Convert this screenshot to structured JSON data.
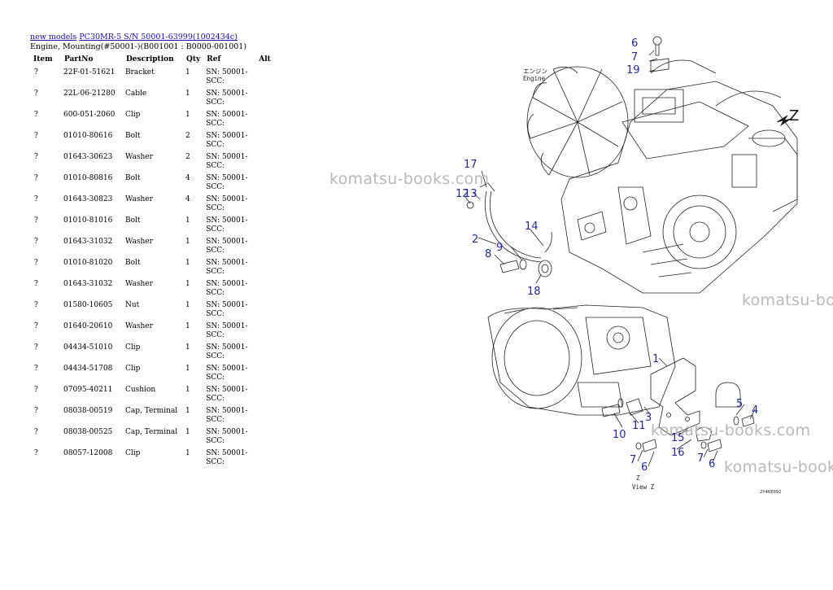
{
  "breadcrumb": {
    "link1": "new models",
    "link2": "PC30MR-5 S/N 50001-63999(1002434c)"
  },
  "subtitle": "Engine, Mounting(#50001-)(B001001 : B0000-001001)",
  "table": {
    "headers": [
      "Item",
      "PartNo",
      "Description",
      "Qty",
      "Ref",
      "Alt"
    ],
    "rows": [
      {
        "item": "?",
        "part": "22F-01-51621",
        "desc": "Bracket",
        "qty": "1",
        "ref": "SN: 50001-SCC:"
      },
      {
        "item": "?",
        "part": "22L-06-21280",
        "desc": "Cable",
        "qty": "1",
        "ref": "SN: 50001-SCC:"
      },
      {
        "item": "?",
        "part": "600-051-2060",
        "desc": "Clip",
        "qty": "1",
        "ref": "SN: 50001-SCC:"
      },
      {
        "item": "?",
        "part": "01010-80616",
        "desc": "Bolt",
        "qty": "2",
        "ref": "SN: 50001-SCC:"
      },
      {
        "item": "?",
        "part": "01643-30623",
        "desc": "Washer",
        "qty": "2",
        "ref": "SN: 50001-SCC:"
      },
      {
        "item": "?",
        "part": "01010-80816",
        "desc": "Bolt",
        "qty": "4",
        "ref": "SN: 50001-SCC:"
      },
      {
        "item": "?",
        "part": "01643-30823",
        "desc": "Washer",
        "qty": "4",
        "ref": "SN: 50001-SCC:"
      },
      {
        "item": "?",
        "part": "01010-81016",
        "desc": "Bolt",
        "qty": "1",
        "ref": "SN: 50001-SCC:"
      },
      {
        "item": "?",
        "part": "01643-31032",
        "desc": "Washer",
        "qty": "1",
        "ref": "SN: 50001-SCC:"
      },
      {
        "item": "?",
        "part": "01010-81020",
        "desc": "Bolt",
        "qty": "1",
        "ref": "SN: 50001-SCC:"
      },
      {
        "item": "?",
        "part": "01643-31032",
        "desc": "Washer",
        "qty": "1",
        "ref": "SN: 50001-SCC:"
      },
      {
        "item": "?",
        "part": "01580-10605",
        "desc": "Nut",
        "qty": "1",
        "ref": "SN: 50001-SCC:"
      },
      {
        "item": "?",
        "part": "01640-20610",
        "desc": "Washer",
        "qty": "1",
        "ref": "SN: 50001-SCC:"
      },
      {
        "item": "?",
        "part": "04434-51010",
        "desc": "Clip",
        "qty": "1",
        "ref": "SN: 50001-SCC:"
      },
      {
        "item": "?",
        "part": "04434-51708",
        "desc": "Clip",
        "qty": "1",
        "ref": "SN: 50001-SCC:"
      },
      {
        "item": "?",
        "part": "07095-40211",
        "desc": "Cushion",
        "qty": "1",
        "ref": "SN: 50001-SCC:"
      },
      {
        "item": "?",
        "part": "08038-00519",
        "desc": "Cap, Terminal",
        "qty": "1",
        "ref": "SN: 50001-SCC:"
      },
      {
        "item": "?",
        "part": "08038-00525",
        "desc": "Cap, Terminal",
        "qty": "1",
        "ref": "SN: 50001-SCC:"
      },
      {
        "item": "?",
        "part": "08057-12008",
        "desc": "Clip",
        "qty": "1",
        "ref": "SN: 50001-SCC:"
      }
    ]
  },
  "diagram": {
    "engine_label_jp": "エンジン",
    "engine_label_en": "Engine",
    "view_label_jp": "Z",
    "view_label_en": "View Z",
    "view_arrow": "Z",
    "drawing_code": "2Y46E092",
    "callouts": [
      "6",
      "7",
      "19",
      "17",
      "13",
      "12",
      "2",
      "14",
      "9",
      "8",
      "18",
      "1",
      "5",
      "4",
      "3",
      "11",
      "10",
      "15",
      "16",
      "7",
      "6",
      "7",
      "6"
    ]
  },
  "watermark": "komatsu-books.com",
  "colors": {
    "link": "#1a0dab",
    "callout": "#1f2a9e",
    "watermark": "#b9b9b9"
  }
}
